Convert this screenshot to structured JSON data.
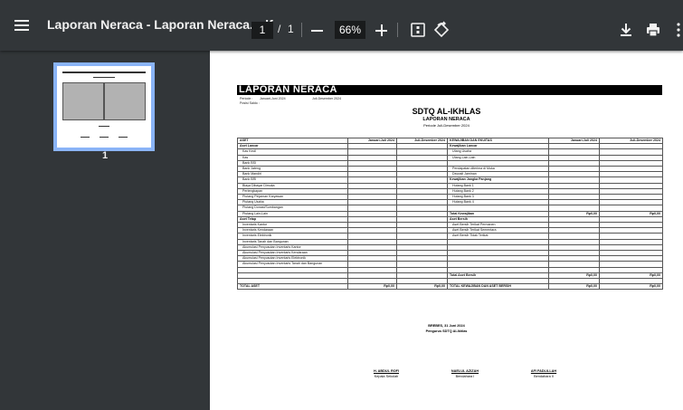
{
  "toolbar": {
    "title": "Laporan Neraca - Laporan Neraca.pdf",
    "page_current": "1",
    "page_separator": "/",
    "page_total": "1",
    "zoom": "66%",
    "icons": [
      "menu-icon",
      "zoom-out-icon",
      "zoom-in-icon",
      "fit-page-icon",
      "rotate-icon",
      "download-icon",
      "print-icon",
      "more-icon"
    ]
  },
  "sidebar": {
    "thumbnail_label": "1"
  },
  "document": {
    "title": "LAPORAN NERACA",
    "periode_label": "Periode :",
    "periode_value1": "Januari-Juni 2024",
    "periode_value2": "Juli-Desember 2024",
    "posisi_label": "Posisi Saldo :",
    "org": "SDTQ AL-IKHLAS",
    "report": "LAPORAN NERACA",
    "period_line": "Periode Juli-Desember 2024",
    "headers": [
      "ASET",
      "Januari-Juli 2024",
      "Juli-Desember 2024",
      "KEWAJIBAN DAN EKUITAS",
      "Januari-Juli 2024",
      "Juli-Desember 2024"
    ],
    "rows": [
      [
        "Aset Lancar",
        "",
        "",
        "Kewajiban Lancar",
        "",
        ""
      ],
      [
        "Kas Kecil",
        "",
        "",
        "Utang Usaha",
        "",
        ""
      ],
      [
        "Kas",
        "",
        "",
        "Utang Lain-Lain",
        "",
        ""
      ],
      [
        "Bank BSI",
        "",
        "",
        "",
        "",
        ""
      ],
      [
        "Bank Jateng",
        "",
        "",
        "Pendapatan diterima di Muka",
        "",
        ""
      ],
      [
        "Bank Mandiri",
        "",
        "",
        "Deposit Jaminan",
        "",
        ""
      ],
      [
        "Bank BRI",
        "",
        "",
        "Kewajiban Jangka Panjang",
        "",
        ""
      ],
      [
        "Biaya Dibayar Dimuka",
        "",
        "",
        "Hutang Bank 1",
        "",
        ""
      ],
      [
        "Perlengkapan",
        "",
        "",
        "Hutang Bank 2",
        "",
        ""
      ],
      [
        "Piutang Pinjaman Karyawan",
        "",
        "",
        "Hutang Bank 3",
        "",
        ""
      ],
      [
        "Piutang Usaha",
        "",
        "",
        "Hutang Bank 4",
        "",
        ""
      ],
      [
        "Piutang Donasi/Sumbangan",
        "",
        "",
        "",
        "",
        ""
      ],
      [
        "Piutang Lain-Lain",
        "",
        "",
        "Total Kewajiban",
        "Rp0,00",
        "Rp0,00"
      ],
      [
        "Aset Tetap",
        "",
        "",
        "Aset Bersih",
        "",
        ""
      ],
      [
        "Inventaris Kantor",
        "",
        "",
        "Aset Bersih Terikat Permanen",
        "",
        ""
      ],
      [
        "Inventaris Kendaraan",
        "",
        "",
        "Aset Bersih Terikat Sementara",
        "",
        ""
      ],
      [
        "Inventaris Elektronik",
        "",
        "",
        "Aset Bersih Tidak Terikat",
        "",
        ""
      ],
      [
        "Inventaris Tanah dan Bangunan",
        "",
        "",
        "",
        "",
        ""
      ],
      [
        "Akumulasi Penyusutan Inventaris Kantor",
        "",
        "",
        "",
        "",
        ""
      ],
      [
        "Akumulasi Penyusutan Inventaris Kendaraan",
        "",
        "",
        "",
        "",
        ""
      ],
      [
        "Akumulasi Penyusutan Inventaris Elektronik",
        "",
        "",
        "",
        "",
        ""
      ],
      [
        "Akumulasi Penyusutan Inventaris Tanah dan Bangunan",
        "",
        "",
        "",
        "",
        ""
      ],
      [
        "",
        "",
        "",
        "",
        "",
        ""
      ],
      [
        "",
        "",
        "",
        "Total Aset Bersih",
        "Rp0,00",
        "Rp0,00"
      ],
      [
        "",
        "",
        "",
        "",
        "",
        ""
      ],
      [
        "TOTAL ASET",
        "Rp0,00",
        "Rp0,00",
        "TOTAL KEWAJIBAN DAN ASET BERSIH",
        "Rp0,00",
        "Rp0,00"
      ]
    ],
    "place_date": "BREBES, 31 Juni 2024",
    "pengurus": "Pengurus SDTQ Al-Ikhlas",
    "signatories": [
      {
        "name": "H. ABDUL ROFI",
        "role": "Kepala Sekolah"
      },
      {
        "name": "NAELUL AZIZAH",
        "role": "Bendahara I"
      },
      {
        "name": "AFI FADLILLAH",
        "role": "Bendahara II"
      }
    ]
  }
}
